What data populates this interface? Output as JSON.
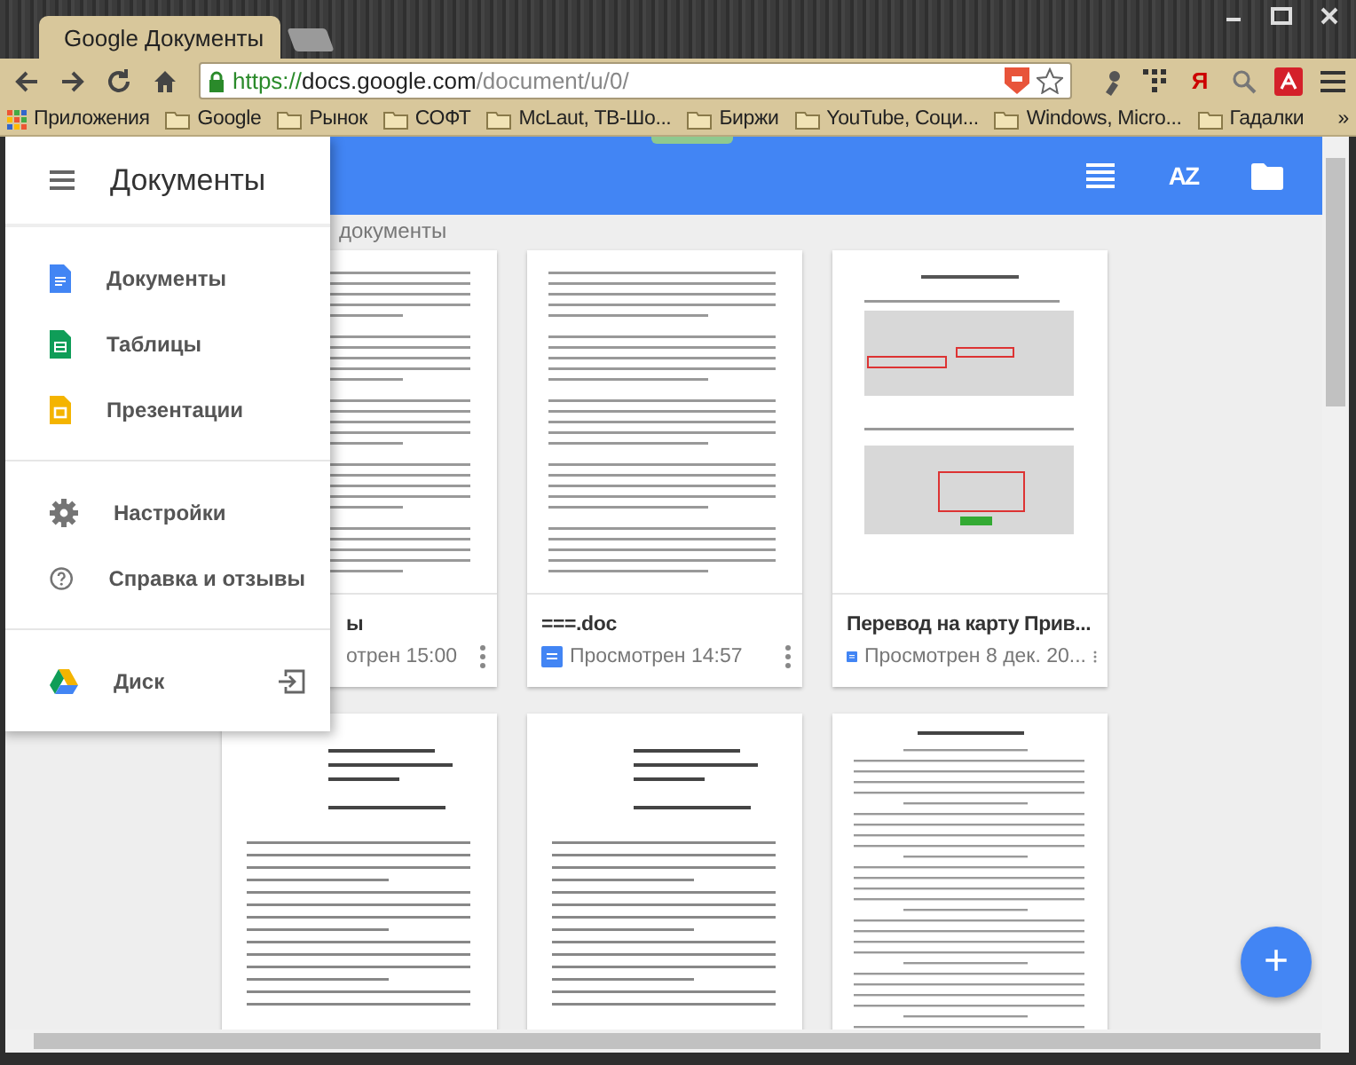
{
  "browser": {
    "tab": {
      "title": "Google Документы"
    },
    "url": {
      "scheme": "https://",
      "host": "docs.google.com",
      "path": "/document/u/0/"
    },
    "extension_letter": "Я",
    "bookmarks": [
      {
        "label": "Приложения",
        "kind": "apps"
      },
      {
        "label": "Google",
        "kind": "folder"
      },
      {
        "label": "Рынок",
        "kind": "folder"
      },
      {
        "label": "СОФТ",
        "kind": "folder"
      },
      {
        "label": "McLaut, ТВ-Шо...",
        "kind": "folder"
      },
      {
        "label": "Биржи",
        "kind": "folder"
      },
      {
        "label": "YouTube, Соци...",
        "kind": "folder"
      },
      {
        "label": "Windows, Micro...",
        "kind": "folder"
      },
      {
        "label": "Гадалки",
        "kind": "folder"
      }
    ],
    "bookmarks_more": "»"
  },
  "app": {
    "drawer": {
      "title": "Документы",
      "groups": [
        [
          {
            "label": "Документы",
            "kind": "docs"
          },
          {
            "label": "Таблицы",
            "kind": "sheets"
          },
          {
            "label": "Презентации",
            "kind": "slides"
          }
        ],
        [
          {
            "label": "Настройки",
            "kind": "settings"
          },
          {
            "label": "Справка и отзывы",
            "kind": "help"
          }
        ],
        [
          {
            "label": "Диск",
            "kind": "drive"
          }
        ]
      ]
    },
    "header": {
      "sort_label": "AZ"
    },
    "section_title": "документы",
    "cards": [
      {
        "kind": "text",
        "title": "ы",
        "viewed": "отрен 15:00"
      },
      {
        "kind": "text",
        "title": "===.doc",
        "viewed": "Просмотрен 14:57"
      },
      {
        "kind": "screenshot",
        "title": "Перевод на карту Прив...",
        "viewed": "Просмотрен 8 дек. 20..."
      },
      {
        "kind": "letter"
      },
      {
        "kind": "letter"
      },
      {
        "kind": "contract"
      }
    ],
    "fab": "+"
  }
}
